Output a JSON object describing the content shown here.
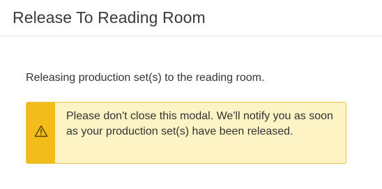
{
  "modal": {
    "title": "Release To Reading Room"
  },
  "body": {
    "message": "Releasing production set(s) to the reading room."
  },
  "warning": {
    "icon": "warning-triangle-icon",
    "text": "Please don't close this modal. We'll notify you as soon as your production set(s) have been released.",
    "colors": {
      "stripe": "#f2bc1b",
      "background": "#fdf3c4",
      "border": "#e8c547"
    }
  }
}
